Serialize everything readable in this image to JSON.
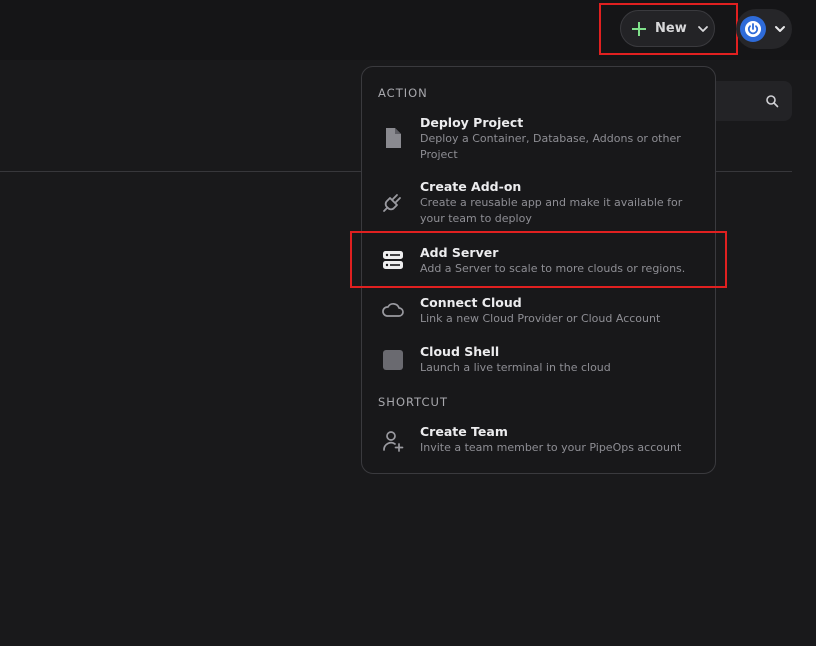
{
  "header": {
    "new_button_label": "New"
  },
  "menu": {
    "sections": [
      {
        "label": "ACTION",
        "items": [
          {
            "title": "Deploy Project",
            "description": "Deploy a Container, Database, Addons or other Project",
            "icon": "file-icon"
          },
          {
            "title": "Create Add-on",
            "description": "Create a reusable app and make it available for your team to deploy",
            "icon": "plug-icon"
          },
          {
            "title": "Add Server",
            "description": "Add a Server to scale to more clouds or regions.",
            "icon": "server-icon"
          },
          {
            "title": "Connect Cloud",
            "description": "Link a new Cloud Provider or Cloud Account",
            "icon": "cloud-icon"
          },
          {
            "title": "Cloud Shell",
            "description": "Launch a live terminal in the cloud",
            "icon": "terminal-icon"
          }
        ]
      },
      {
        "label": "SHORTCUT",
        "items": [
          {
            "title": "Create Team",
            "description": "Invite a team member to your PipeOps account",
            "icon": "user-plus-icon"
          }
        ]
      }
    ]
  },
  "colors": {
    "background": "#19191b",
    "topbar": "#151517",
    "highlight": "#e02020",
    "plus_accent": "#7fe08a",
    "avatar": "#2e6bd9"
  }
}
